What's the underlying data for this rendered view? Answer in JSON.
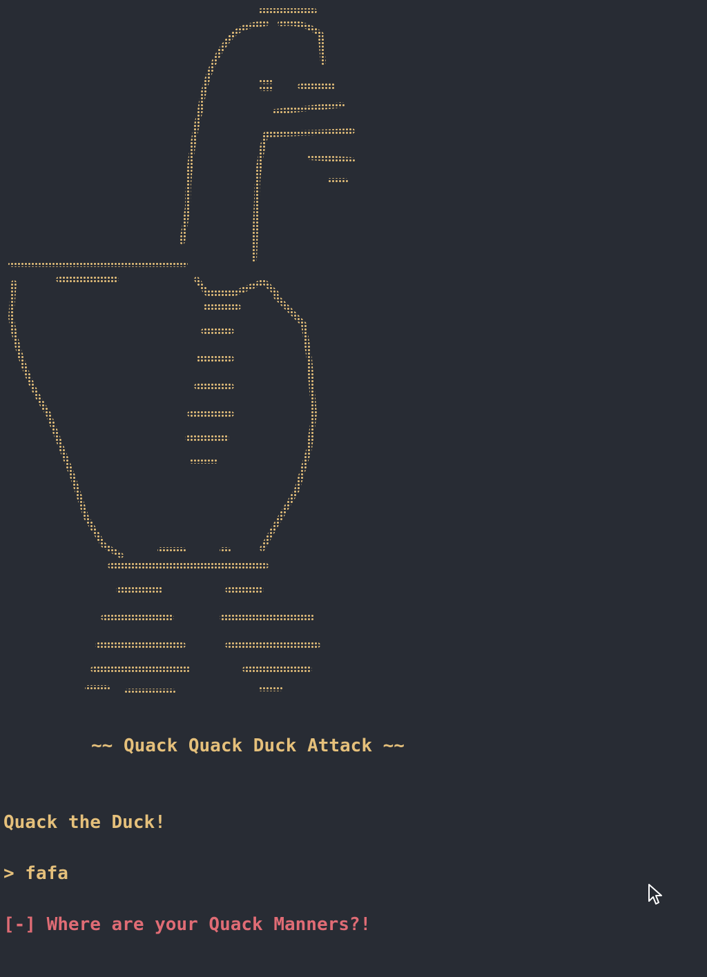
{
  "colors": {
    "background": "#282c34",
    "art": "#e5c07b",
    "text": "#e5c07b",
    "error": "#e06c75",
    "cursor": "#ffffff"
  },
  "art": {
    "icon": "duck-ascii-art"
  },
  "terminal": {
    "banner": "~~ Quack Quack Duck Attack ~~",
    "prompt": "Quack the Duck!",
    "input": "> fafa",
    "error": "[-] Where are your Quack Manners?!"
  },
  "cursor": {
    "icon": "mouse-pointer-icon"
  }
}
